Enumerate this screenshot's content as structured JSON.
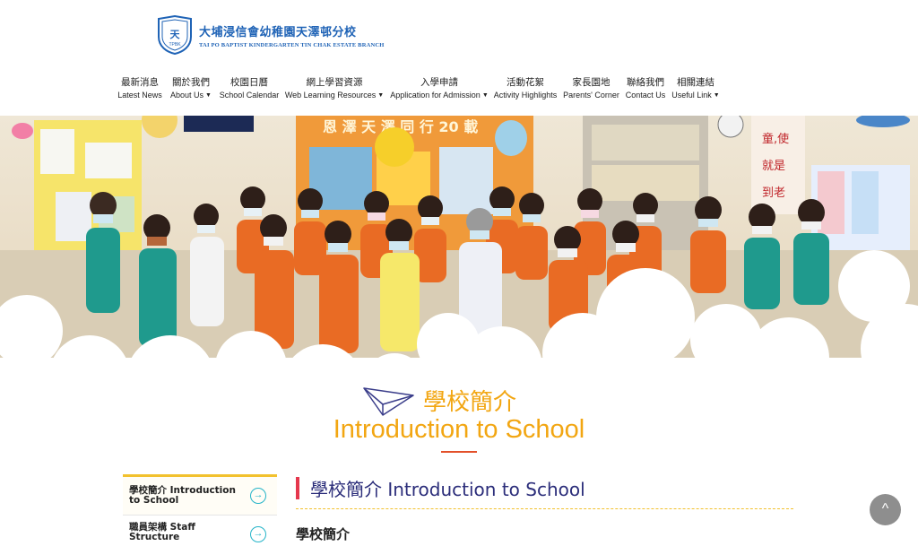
{
  "school": {
    "name_cn": "大埔浸信會幼稚園天澤邨分校",
    "name_en": "TAI PO BAPTIST KINDERGARTEN TIN CHAK ESTATE BRANCH",
    "crest_text": "TPBK"
  },
  "nav": [
    {
      "cn": "最新消息",
      "en": "Latest News",
      "dropdown": false
    },
    {
      "cn": "關於我們",
      "en": "About Us",
      "dropdown": true
    },
    {
      "cn": "校園日曆",
      "en": "School Calendar",
      "dropdown": false
    },
    {
      "cn": "網上學習資源",
      "en": "Web Learning Resources",
      "dropdown": true
    },
    {
      "cn": "入學申請",
      "en": "Application for Admission",
      "dropdown": true
    },
    {
      "cn": "活動花絮",
      "en": "Activity Highlights",
      "dropdown": false
    },
    {
      "cn": "家長園地",
      "en": "Parents' Corner",
      "dropdown": false
    },
    {
      "cn": "聯絡我們",
      "en": "Contact Us",
      "dropdown": false
    },
    {
      "cn": "相關連結",
      "en": "Useful Link",
      "dropdown": true
    }
  ],
  "hero": {
    "banner_text": "恩 澤 天 澤 同 行 20 載"
  },
  "intro": {
    "title_cn": "學校簡介",
    "title_en": "Introduction to School"
  },
  "sidebar": [
    {
      "label": "學校簡介 Introduction to School",
      "active": true
    },
    {
      "label": "職員架構 Staff Structure",
      "active": false
    }
  ],
  "main": {
    "title": "學校簡介 Introduction to School",
    "subtitle": "學校簡介"
  },
  "icons": {
    "arrow": "circle-arrow-right-icon",
    "back_to_top": "chevron-up-icon",
    "plane": "paper-plane-icon"
  },
  "colors": {
    "accent_orange": "#f2a612",
    "brand_blue": "#1f63b6",
    "title_navy": "#2b2d7a",
    "teal": "#25b4c8"
  }
}
